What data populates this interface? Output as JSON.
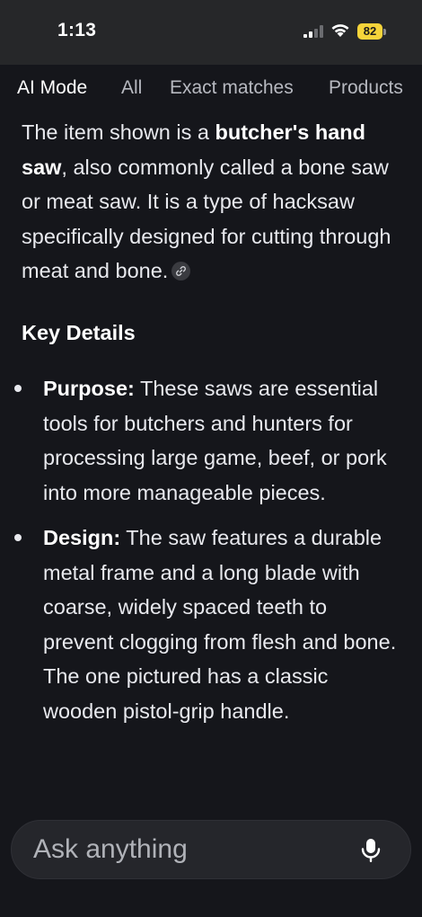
{
  "status_bar": {
    "time": "1:13",
    "battery": "82",
    "battery_color": "#f6d43a",
    "icons": [
      "signal-icon",
      "wifi-icon",
      "battery-icon"
    ]
  },
  "tabs": [
    {
      "label": "AI Mode",
      "active": true
    },
    {
      "label": "All",
      "active": false
    },
    {
      "label": "Exact matches",
      "active": false
    },
    {
      "label": "Products",
      "active": false
    }
  ],
  "intro": {
    "part1": "The item shown is a ",
    "bold": "butcher's hand saw",
    "part2": ", also commonly called a bone saw or meat saw. It is a type of hacksaw specifically designed for cutting through meat and bone.",
    "link_icon": "link-icon"
  },
  "section_heading": "Key Details",
  "bullets": [
    {
      "term": "Purpose:",
      "text": " These saws are essential tools for butchers and hunters for processing large game, beef, or pork into more manageable pieces."
    },
    {
      "term": "Design:",
      "text": " The saw features a durable metal frame and a long blade with coarse, widely spaced teeth to prevent clogging from flesh and bone. The one pictured has a classic wooden pistol-grip handle."
    }
  ],
  "ask": {
    "placeholder": "Ask anything",
    "mic_icon": "microphone-icon"
  }
}
